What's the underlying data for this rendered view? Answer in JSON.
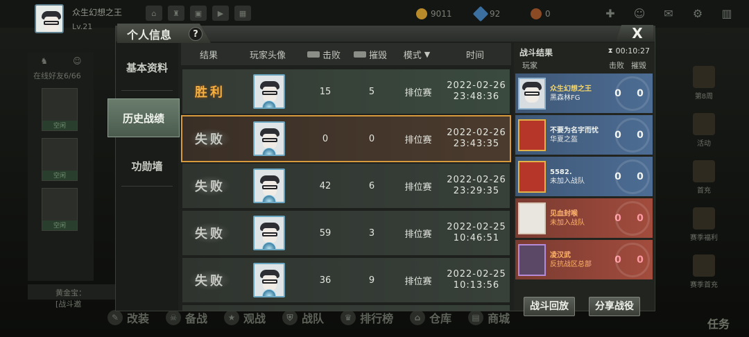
{
  "top": {
    "player_name": "众生幻想之王",
    "level": "Lv.21",
    "icons": [
      "home-icon",
      "rank-icon",
      "gift-icon",
      "live-icon",
      "more-icon"
    ],
    "gold": "9011",
    "diamond": "92",
    "token": "0"
  },
  "modal": {
    "title": "个人信息",
    "help": "?",
    "close": "X",
    "side_nav": [
      {
        "label": "基本资料",
        "active": false
      },
      {
        "label": "历史战绩",
        "active": true
      },
      {
        "label": "功勋墙",
        "active": false
      }
    ],
    "table": {
      "headers": {
        "result": "结果",
        "avatar": "玩家头像",
        "kills": "击败",
        "destroy": "摧毁",
        "mode": "模式",
        "time": "时间"
      },
      "rows": [
        {
          "result": "胜利",
          "outcome": "win",
          "kills": "15",
          "destroy": "5",
          "mode": "排位赛",
          "date": "2022-02-26",
          "clock": "23:48:36"
        },
        {
          "result": "失败",
          "outcome": "lose",
          "kills": "0",
          "destroy": "0",
          "mode": "排位赛",
          "date": "2022-02-26",
          "clock": "23:43:35"
        },
        {
          "result": "失败",
          "outcome": "lose",
          "kills": "42",
          "destroy": "6",
          "mode": "排位赛",
          "date": "2022-02-26",
          "clock": "23:29:35"
        },
        {
          "result": "失败",
          "outcome": "lose",
          "kills": "59",
          "destroy": "3",
          "mode": "排位赛",
          "date": "2022-02-25",
          "clock": "10:46:51"
        },
        {
          "result": "失败",
          "outcome": "lose",
          "kills": "36",
          "destroy": "9",
          "mode": "排位赛",
          "date": "2022-02-25",
          "clock": "10:13:56"
        }
      ]
    },
    "battle": {
      "title": "战斗结果",
      "timer": "00:10:27",
      "headers": {
        "player": "玩家",
        "kills": "击败",
        "destroy": "摧毁"
      },
      "players": [
        {
          "name": "众生幻想之王",
          "clan": "黑森林FG",
          "kills": "0",
          "destroy": "0",
          "team": "blue"
        },
        {
          "name": "不要为名字而忧",
          "clan": "华夏之盔",
          "kills": "0",
          "destroy": "0",
          "team": "blue"
        },
        {
          "name": "5582.",
          "clan": "未加入战队",
          "kills": "0",
          "destroy": "0",
          "team": "blue"
        },
        {
          "name": "见血封喉",
          "clan": "未加入战队",
          "kills": "0",
          "destroy": "0",
          "team": "red"
        },
        {
          "name": "凌汉武",
          "clan": "反抗战区总部",
          "kills": "0",
          "destroy": "0",
          "team": "red"
        }
      ],
      "replay_label": "战斗回放",
      "share_label": "分享战役"
    }
  },
  "left_panel": {
    "friends_count": "在线好友6/66",
    "friend_status": "空闲",
    "chat_text": "黄金宝：[战斗邀"
  },
  "bottom_nav": [
    "改装",
    "备战",
    "观战",
    "战队",
    "排行榜",
    "仓库",
    "商城"
  ],
  "right_side": [
    "第8周",
    "活动",
    "首充",
    "赛季福利",
    "赛季首充"
  ],
  "task_label": "任务"
}
